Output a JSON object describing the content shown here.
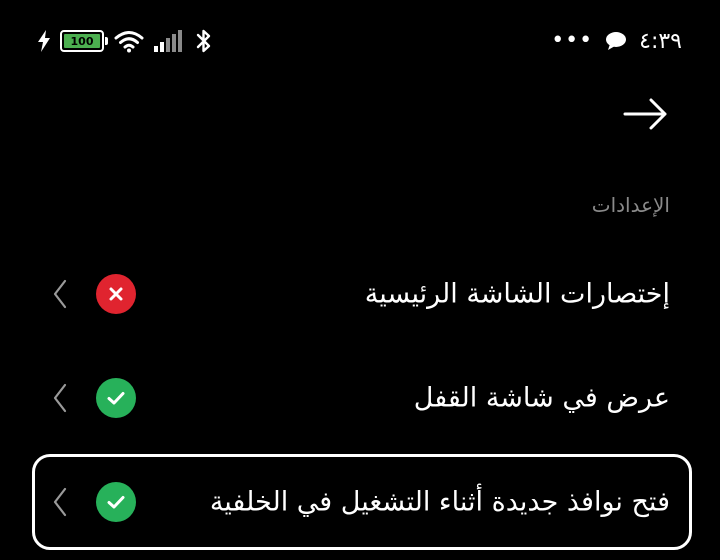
{
  "status_bar": {
    "battery_level": "100",
    "time": "٤:٣٩",
    "icons": [
      "charging-icon",
      "battery-icon",
      "wifi-icon",
      "signal-icon",
      "bluetooth-icon",
      "more-dots-icon",
      "chat-bubble-icon"
    ]
  },
  "header": {
    "back_icon": "arrow-right-icon"
  },
  "section": {
    "title": "الإعدادات"
  },
  "settings": [
    {
      "label": "إختصارات الشاشة الرئيسية",
      "status": "denied",
      "status_color": "#e0242f",
      "selected": false
    },
    {
      "label": "عرض في شاشة القفل",
      "status": "allowed",
      "status_color": "#27b15a",
      "selected": false
    },
    {
      "label": "فتح نوافذ جديدة أثناء التشغيل في الخلفية",
      "status": "allowed",
      "status_color": "#27b15a",
      "selected": true
    }
  ],
  "colors": {
    "background": "#000000",
    "text": "#ffffff",
    "section_header": "#8a8a8a",
    "battery_fill": "#4caf50"
  }
}
